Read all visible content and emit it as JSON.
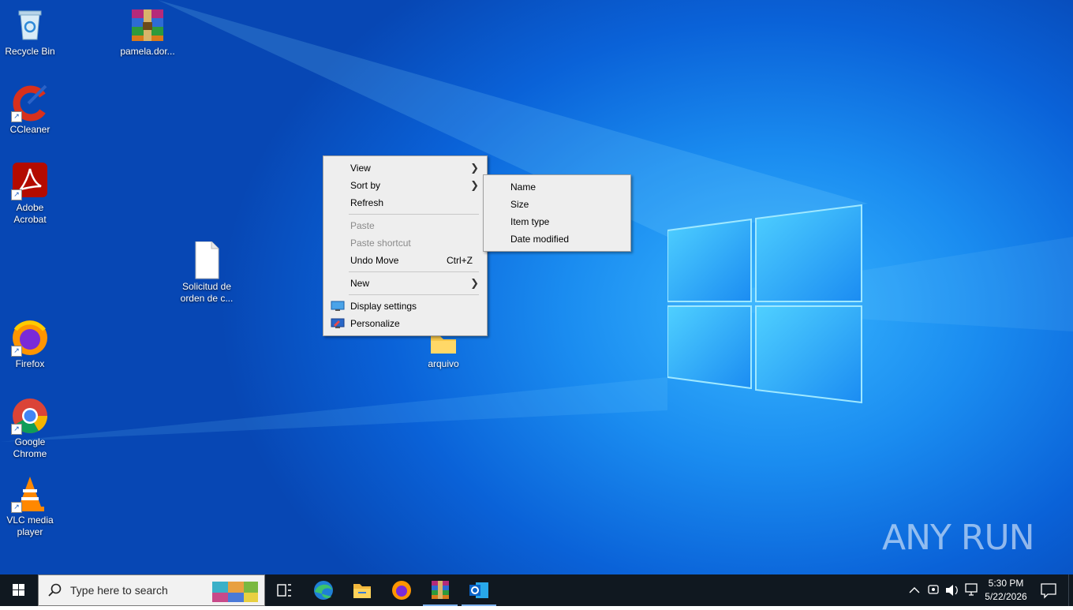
{
  "desktop_icons": [
    {
      "label": "Recycle Bin",
      "icon": "recycle-bin-icon"
    },
    {
      "label": "pamela.dor...",
      "icon": "winrar-archive-icon"
    },
    {
      "label": "CCleaner",
      "icon": "ccleaner-icon"
    },
    {
      "label": "Adobe Acrobat",
      "icon": "adobe-acrobat-icon"
    },
    {
      "label": "Solicitud de orden de c...",
      "icon": "blank-file-icon"
    },
    {
      "label": "Firefox",
      "icon": "firefox-icon"
    },
    {
      "label": "arquivo",
      "icon": "folder-icon"
    },
    {
      "label": "Google Chrome",
      "icon": "chrome-icon"
    },
    {
      "label": "VLC media player",
      "icon": "vlc-icon"
    }
  ],
  "context_menu": {
    "items": [
      {
        "label": "View",
        "submenu": true
      },
      {
        "label": "Sort by",
        "submenu": true
      },
      {
        "label": "Refresh"
      },
      {
        "label": "Paste",
        "disabled": true
      },
      {
        "label": "Paste shortcut",
        "disabled": true
      },
      {
        "label": "Undo Move",
        "accelerator": "Ctrl+Z"
      },
      {
        "label": "New",
        "submenu": true
      },
      {
        "label": "Display settings",
        "icon": "display-settings-icon"
      },
      {
        "label": "Personalize",
        "icon": "personalize-icon"
      }
    ]
  },
  "sort_submenu": {
    "items": [
      "Name",
      "Size",
      "Item type",
      "Date modified"
    ]
  },
  "taskbar": {
    "search_placeholder": "Type here to search",
    "apps": [
      "task-view-icon",
      "edge-icon",
      "file-explorer-icon",
      "firefox-icon",
      "winrar-icon",
      "outlook-icon"
    ],
    "clock_time": "5:30 PM",
    "clock_date": "5/22/2026"
  },
  "watermark": "ANY RUN",
  "colors": {
    "desktop_accent": "#1a8cf0",
    "taskbar_bg": "#101820",
    "menu_bg": "#eeeeee"
  }
}
